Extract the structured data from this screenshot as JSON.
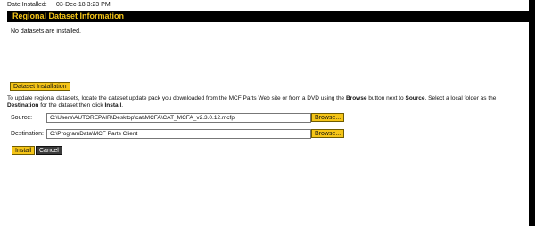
{
  "install_info": {
    "date_label": "Date Installed:",
    "date_value": "03-Dec-18 3:23 PM"
  },
  "section": {
    "title": "Regional Dataset Information",
    "status_text": "No datasets are installed.",
    "dataset_button_label": "Dataset Installation"
  },
  "instructions": {
    "text_1": "To update regional datasets, locate the dataset update pack you downloaded from the MCF Parts Web site or from a DVD using the ",
    "bold_1": "Browse",
    "text_2": " button next to ",
    "bold_2": "Source",
    "text_3": ". Select a local folder as the ",
    "bold_3": "Destination",
    "text_4": " for the dataset then click ",
    "bold_4": "Install",
    "text_5": "."
  },
  "fields": {
    "source_label": "Source:",
    "source_value": "C:\\Users\\AUTOREPAIR\\Desktop\\cat\\MCFA\\CAT_MCFA_v2.3.0.12.mcfp",
    "destination_label": "Destination:",
    "destination_value": "C:\\ProgramData\\MCF Parts Client",
    "browse_label": "Browse..."
  },
  "actions": {
    "install_label": "Install",
    "cancel_label": "Cancel"
  },
  "colors": {
    "accent": "#f5c518",
    "header_background": "#000000",
    "cancel_background": "#3b3b3b"
  }
}
